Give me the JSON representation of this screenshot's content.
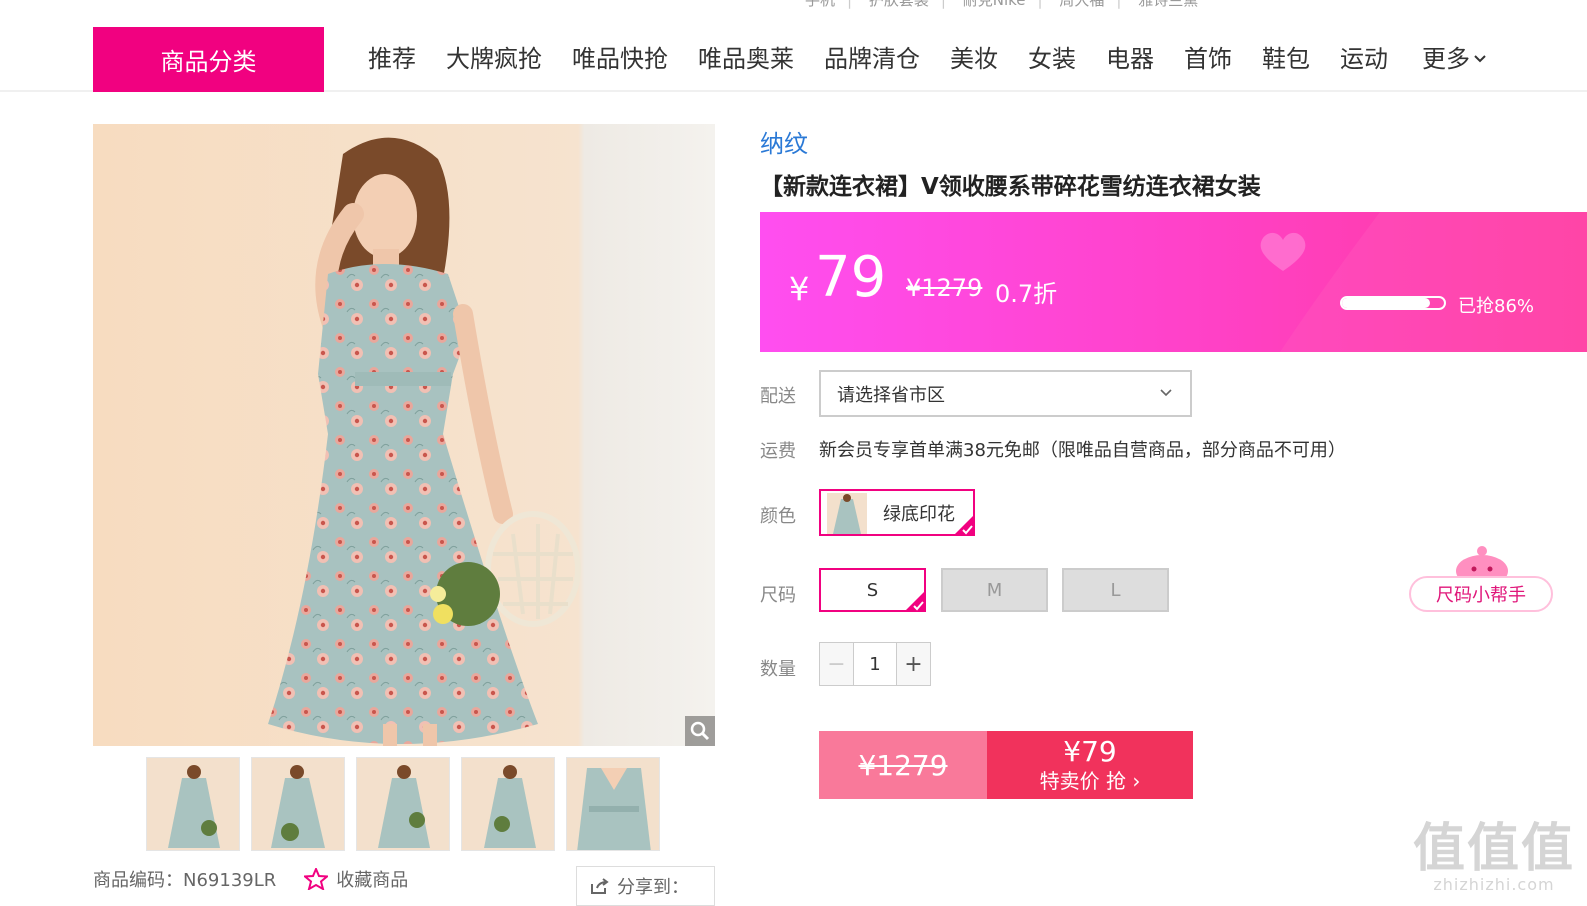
{
  "hot_search": [
    "手机",
    "护肤套装",
    "耐克Nike",
    "周大福",
    "雅诗兰黛"
  ],
  "nav": {
    "category_button": "商品分类",
    "items": [
      "推荐",
      "大牌疯抢",
      "唯品快抢",
      "唯品奥莱",
      "品牌清仓",
      "美妆",
      "女装",
      "电器",
      "首饰",
      "鞋包",
      "运动"
    ],
    "more": "更多"
  },
  "product": {
    "brand": "纳纹",
    "title": "【新款连衣裙】V领收腰系带碎花雪纺连衣裙女装",
    "price": {
      "currency": "¥",
      "current": "79",
      "original": "¥1279",
      "discount": "0.7折",
      "sold_percent": 0.86,
      "sold_label": "已抢86%"
    },
    "delivery_label": "配送",
    "delivery_placeholder": "请选择省市区",
    "freight_label": "运费",
    "freight_text": "新会员专享首单满38元免邮（限唯品自营商品，部分商品不可用）",
    "color_label": "颜色",
    "color_option": "绿底印花",
    "size_label": "尺码",
    "sizes": [
      "S",
      "M",
      "L"
    ],
    "selected_size": "S",
    "size_helper": "尺码小帮手",
    "qty_label": "数量",
    "qty": "1",
    "buy": {
      "original": "¥1279",
      "price": "¥79",
      "cta": "特卖价 抢 ›"
    },
    "code": "商品编码：N69139LR",
    "favorite": "收藏商品",
    "share": "分享到："
  },
  "watermark": {
    "main": "值值值",
    "sub": "zhizhizhi.com"
  },
  "colors": {
    "brand_pink": "#f10180",
    "buy_red": "#f1325c",
    "link_blue": "#2a79d6"
  }
}
